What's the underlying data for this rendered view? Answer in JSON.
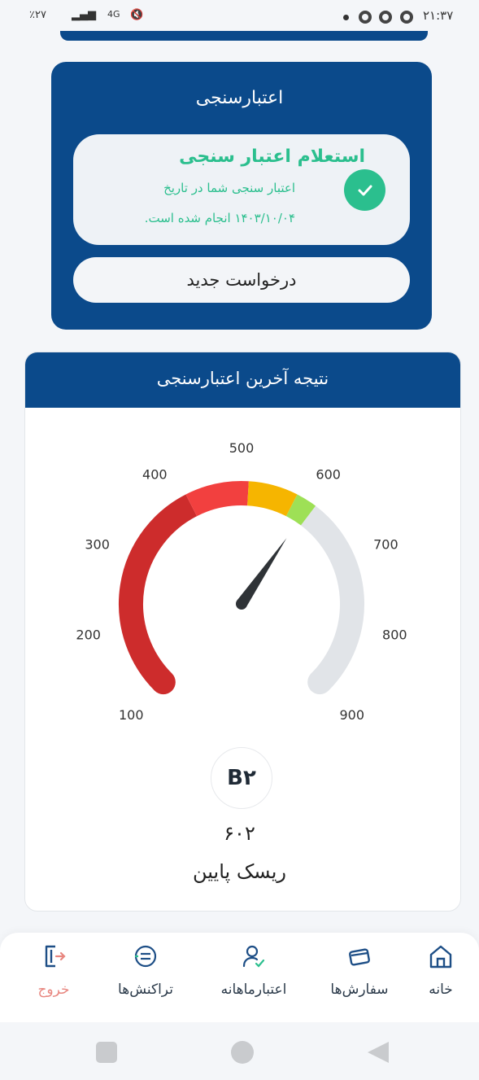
{
  "status_bar": {
    "time": "۲۱:۳۷",
    "battery": "٪۲۷",
    "network": "4G"
  },
  "credit_check": {
    "title": "اعتبارسنجی",
    "status_heading": "استعلام اعتبار سنجی",
    "status_line1": "اعتبار سنجی شما در تاریخ",
    "status_line2": "۱۴۰۳/۱۰/۰۴ انجام شده است.",
    "new_request_label": "درخواست جدید",
    "status_icon": "check-icon",
    "accent_color": "#2bbf8e"
  },
  "latest_result": {
    "title": "نتیجه آخرین اعتبارسنجی",
    "gauge": {
      "min": 100,
      "max": 900,
      "ticks": [
        "100",
        "200",
        "300",
        "400",
        "500",
        "600",
        "700",
        "800",
        "900"
      ],
      "score": 602,
      "segments": [
        {
          "from": 100,
          "to": 420,
          "color": "#cd2c2c"
        },
        {
          "from": 420,
          "to": 510,
          "color": "#f2403f"
        },
        {
          "from": 510,
          "to": 580,
          "color": "#f6b500"
        },
        {
          "from": 580,
          "to": 610,
          "color": "#9ee056"
        },
        {
          "from": 610,
          "to": 900,
          "color": "#e1e4e8"
        }
      ]
    },
    "grade": "B۲",
    "score_text": "۶۰۲",
    "risk_label": "ریسک پایین"
  },
  "bottom_nav": {
    "items": [
      {
        "label": "خانه",
        "icon": "home-icon"
      },
      {
        "label": "سفارش‌ها",
        "icon": "card-icon"
      },
      {
        "label": "اعتبارماهانه",
        "icon": "user-check-icon"
      },
      {
        "label": "تراکنش‌ها",
        "icon": "transactions-icon"
      },
      {
        "label": "خروج",
        "icon": "logout-icon"
      }
    ]
  },
  "colors": {
    "brand_blue": "#0b4a8b",
    "success_green": "#2bbf8e",
    "exit_red": "#e8867f"
  }
}
